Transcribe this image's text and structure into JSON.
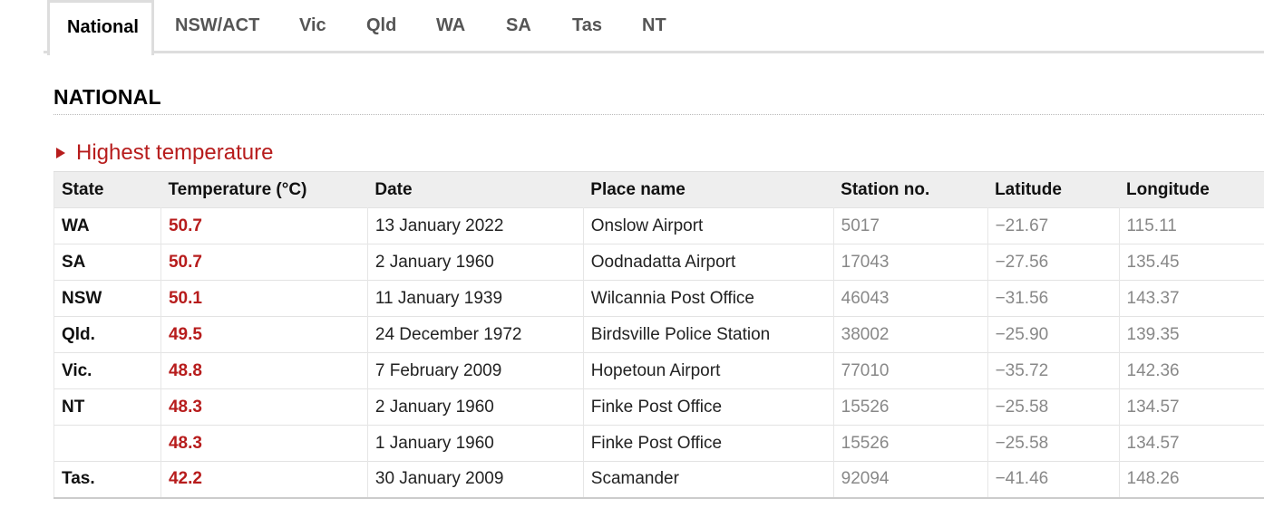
{
  "tabs": [
    {
      "label": "National",
      "active": true
    },
    {
      "label": "NSW/ACT",
      "active": false
    },
    {
      "label": "Vic",
      "active": false
    },
    {
      "label": "Qld",
      "active": false
    },
    {
      "label": "WA",
      "active": false
    },
    {
      "label": "SA",
      "active": false
    },
    {
      "label": "Tas",
      "active": false
    },
    {
      "label": "NT",
      "active": false
    }
  ],
  "heading": "NATIONAL",
  "section": {
    "title": "Highest temperature",
    "icon": "triangle-right-icon",
    "accent_color": "#b71c1c"
  },
  "table": {
    "headers": [
      "State",
      "Temperature (°C)",
      "Date",
      "Place name",
      "Station no.",
      "Latitude",
      "Longitude"
    ],
    "rows": [
      [
        "WA",
        "50.7",
        "13 January 2022",
        "Onslow Airport",
        "5017",
        "−21.67",
        "115.11"
      ],
      [
        "SA",
        "50.7",
        "2 January 1960",
        "Oodnadatta Airport",
        "17043",
        "−27.56",
        "135.45"
      ],
      [
        "NSW",
        "50.1",
        "11 January 1939",
        "Wilcannia Post Office",
        "46043",
        "−31.56",
        "143.37"
      ],
      [
        "Qld.",
        "49.5",
        "24 December 1972",
        "Birdsville Police Station",
        "38002",
        "−25.90",
        "139.35"
      ],
      [
        "Vic.",
        "48.8",
        "7 February 2009",
        "Hopetoun Airport",
        "77010",
        "−35.72",
        "142.36"
      ],
      [
        "NT",
        "48.3",
        "2 January 1960",
        "Finke Post Office",
        "15526",
        "−25.58",
        "134.57"
      ],
      [
        "",
        "48.3",
        "1 January 1960",
        "Finke Post Office",
        "15526",
        "−25.58",
        "134.57"
      ],
      [
        "Tas.",
        "42.2",
        "30 January 2009",
        "Scamander",
        "92094",
        "−41.46",
        "148.26"
      ]
    ]
  }
}
